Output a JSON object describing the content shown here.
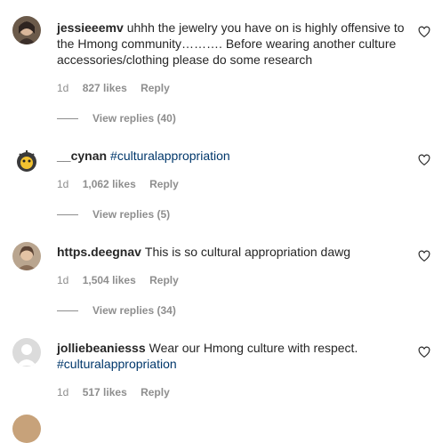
{
  "comments": [
    {
      "username": "jessieeemv",
      "text": "uhhh the jewelry you have on is highly offensive to the Hmong community………. Before wearing another culture accessories/clothing please do some research",
      "hashtag": "",
      "time": "1d",
      "likes": "827 likes",
      "reply": "Reply",
      "view_replies": "View replies (40)"
    },
    {
      "username": "__cynan",
      "text": "",
      "hashtag": "#culturalappropriation",
      "time": "1d",
      "likes": "1,062 likes",
      "reply": "Reply",
      "view_replies": "View replies (5)"
    },
    {
      "username": "https.deegnav",
      "text": "This is so cultural appropriation dawg",
      "hashtag": "",
      "time": "1d",
      "likes": "1,504 likes",
      "reply": "Reply",
      "view_replies": "View replies (34)"
    },
    {
      "username": "jolliebeaniesss",
      "text": "Wear our Hmong culture with respect.",
      "hashtag": "#culturalappropriation",
      "time": "1d",
      "likes": "517 likes",
      "reply": "Reply",
      "view_replies": ""
    }
  ],
  "icons": {
    "like": "heart-outline-icon"
  },
  "colors": {
    "hashtag": "#00376b",
    "meta": "#8e8e8e"
  }
}
